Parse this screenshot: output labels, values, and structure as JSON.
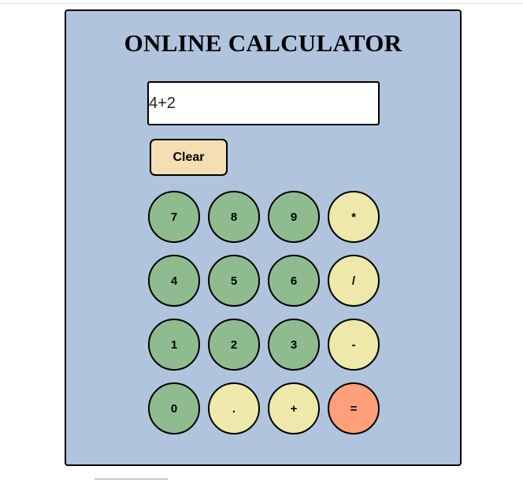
{
  "title": "ONLINE CALCULATOR",
  "display": {
    "value": "4+2"
  },
  "clear": {
    "label": "Clear"
  },
  "keys": [
    {
      "label": "7",
      "role": "digit"
    },
    {
      "label": "8",
      "role": "digit"
    },
    {
      "label": "9",
      "role": "digit"
    },
    {
      "label": "*",
      "role": "operator"
    },
    {
      "label": "4",
      "role": "digit"
    },
    {
      "label": "5",
      "role": "digit"
    },
    {
      "label": "6",
      "role": "digit"
    },
    {
      "label": "/",
      "role": "operator"
    },
    {
      "label": "1",
      "role": "digit"
    },
    {
      "label": "2",
      "role": "digit"
    },
    {
      "label": "3",
      "role": "digit"
    },
    {
      "label": "-",
      "role": "operator"
    },
    {
      "label": "0",
      "role": "digit"
    },
    {
      "label": ".",
      "role": "operator"
    },
    {
      "label": "+",
      "role": "operator"
    },
    {
      "label": "=",
      "role": "equals"
    }
  ],
  "colors": {
    "panel": "#b0c4de",
    "digit": "#8fbc8f",
    "operator": "#eee8aa",
    "equals": "#ffa07a",
    "clear": "#f5deb3"
  }
}
